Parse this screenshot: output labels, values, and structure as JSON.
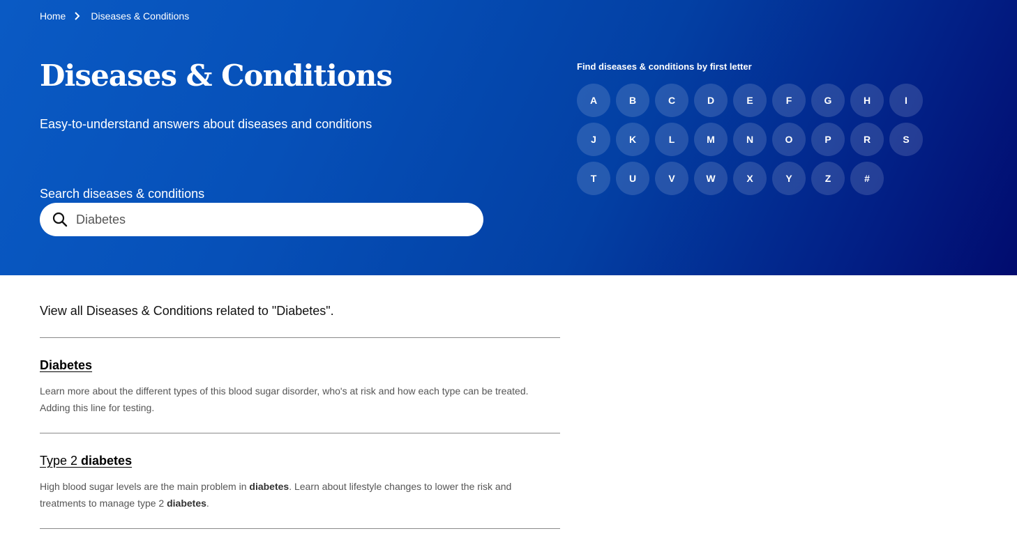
{
  "breadcrumb": {
    "home": "Home",
    "current": "Diseases & Conditions"
  },
  "hero": {
    "title": "Diseases & Conditions",
    "subtitle": "Easy-to-understand answers about diseases and conditions",
    "search_label": "Search diseases & conditions",
    "search_value": "Diabetes"
  },
  "letters": {
    "heading": "Find diseases & conditions by first letter",
    "items": [
      "A",
      "B",
      "C",
      "D",
      "E",
      "F",
      "G",
      "H",
      "I",
      "J",
      "K",
      "L",
      "M",
      "N",
      "O",
      "P",
      "R",
      "S",
      "T",
      "U",
      "V",
      "W",
      "X",
      "Y",
      "Z",
      "#"
    ]
  },
  "results": {
    "intro": "View all Diseases & Conditions related to \"Diabetes\".",
    "items": [
      {
        "title_plain": "",
        "title_bold": "Diabetes",
        "desc_pre": "Learn more about the different types of this blood sugar disorder, who's at risk and how each type can be treated. Adding this line for testing.",
        "desc_bold1": "",
        "desc_mid": "",
        "desc_bold2": "",
        "desc_post": ""
      },
      {
        "title_plain": "Type 2 ",
        "title_bold": "diabetes",
        "desc_pre": "High blood sugar levels are the main problem in ",
        "desc_bold1": "diabetes",
        "desc_mid": ". Learn about lifestyle changes to lower the risk and treatments to manage type 2 ",
        "desc_bold2": "diabetes",
        "desc_post": "."
      }
    ]
  },
  "colors": {
    "hero_start": "#0a5ac4",
    "hero_end": "#010b6e",
    "divider": "#8a8a8a"
  }
}
